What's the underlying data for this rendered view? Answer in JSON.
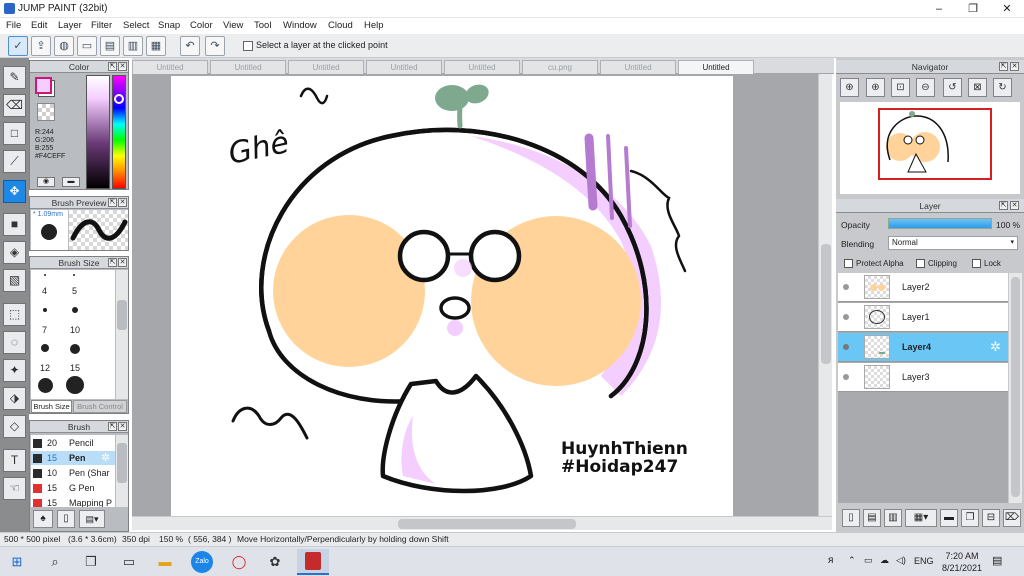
{
  "window": {
    "title": "JUMP PAINT (32bit)",
    "controls": [
      "–",
      "❐",
      "✕"
    ]
  },
  "menu": [
    "File",
    "Edit",
    "Layer",
    "Filter",
    "Select",
    "Snap",
    "Color",
    "View",
    "Tool",
    "Window",
    "Cloud",
    "Help"
  ],
  "toolbar": {
    "select_layer_label": "Select a layer at the clicked point"
  },
  "tabs": [
    "Untitled",
    "Untitled",
    "Untitled",
    "Untitled",
    "Untitled",
    "cu.png",
    "Untitled",
    "Untitled"
  ],
  "active_tab_index": 7,
  "color_panel": {
    "title": "Color",
    "r": "R:244",
    "g": "G:206",
    "b": "B:255",
    "hex": "#F4CEFF",
    "swatch_color": "#F4CEFF"
  },
  "brush_preview": {
    "title": "Brush Preview",
    "size": "* 1.09mm"
  },
  "brush_size": {
    "title": "Brush Size",
    "sizes": [
      "4",
      "5",
      "7",
      "10",
      "12",
      "15"
    ],
    "tab_active": "Brush Size",
    "tab_inactive": "Brush Control"
  },
  "brush_list": {
    "title": "Brush",
    "items": [
      {
        "size": "20",
        "name": "Pencil"
      },
      {
        "size": "15",
        "name": "Pen"
      },
      {
        "size": "10",
        "name": "Pen (Shar"
      },
      {
        "size": "15",
        "name": "G Pen"
      },
      {
        "size": "15",
        "name": "Mapping P"
      }
    ],
    "selected_index": 1
  },
  "artwork": {
    "handwriting": "Ghê",
    "watermark_line1": "HuynhThienn",
    "watermark_line2": "#Hoidap247"
  },
  "navigator": {
    "title": "Navigator"
  },
  "layer_panel": {
    "title": "Layer",
    "opacity_label": "Opacity",
    "opacity_value": "100 %",
    "blending_label": "Blending",
    "blending_value": "Normal",
    "protect_alpha": "Protect Alpha",
    "clipping": "Clipping",
    "lock": "Lock",
    "layers": [
      "Layer2",
      "Layer1",
      "Layer4",
      "Layer3"
    ],
    "selected_index": 2
  },
  "status": {
    "canvas_size": "500 * 500 pixel",
    "physical_size": "(3.6 * 3.6cm)",
    "dpi": "350 dpi",
    "zoom": "150 %",
    "coords": "( 556, 384 )",
    "hint": "Move Horizontally/Perpendicularly by holding down Shift"
  },
  "taskbar": {
    "time": "7:20 AM",
    "date": "8/21/2021",
    "lang": "ENG"
  },
  "colors": {
    "accent": "#1E88E5",
    "skin": "#FFD39A",
    "lilac": "#F4CEFF",
    "purple_stroke": "#B57BD1",
    "sprout": "#7FA98E"
  }
}
